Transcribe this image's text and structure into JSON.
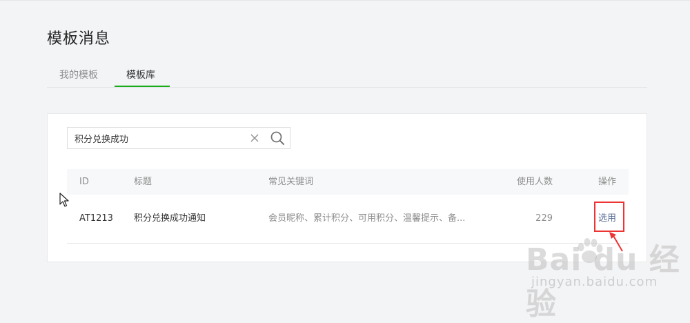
{
  "page": {
    "title": "模板消息"
  },
  "tabs": [
    {
      "label": "我的模板",
      "active": false
    },
    {
      "label": "模板库",
      "active": true
    }
  ],
  "search": {
    "value": "积分兑换成功",
    "placeholder": ""
  },
  "table": {
    "headers": {
      "id": "ID",
      "title": "标题",
      "keywords": "常见关键词",
      "count": "使用人数",
      "action": "操作"
    },
    "rows": [
      {
        "id": "AT1213",
        "title": "积分兑换成功通知",
        "keywords": "会员昵称、累计积分、可用积分、温馨提示、备...",
        "count": "229",
        "action": "选用"
      }
    ]
  },
  "watermark": {
    "logo": "Bai du 经验",
    "url": "jingyan.baidu.com"
  },
  "colors": {
    "accent": "#1aad19",
    "link": "#576b95",
    "highlight": "#ee3333"
  }
}
